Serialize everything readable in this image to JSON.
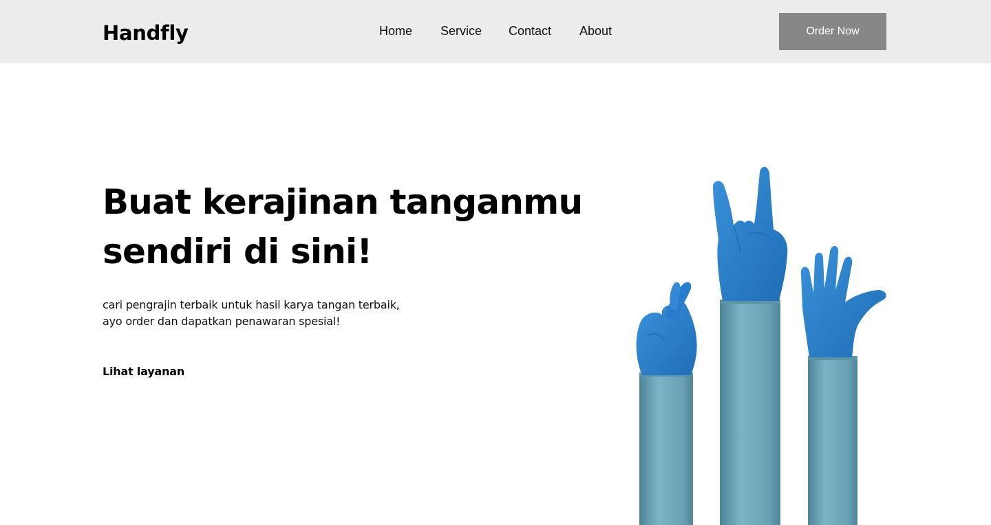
{
  "header": {
    "logo": "Handfly",
    "nav": [
      "Home",
      "Service",
      "Contact",
      "About"
    ],
    "order_button": "Order Now"
  },
  "hero": {
    "title_line1": "Buat kerajinan tanganmu",
    "title_line2": "sendiri di sini!",
    "subtitle_line1": "cari pengrajin terbaik untuk hasil karya tangan terbaik,",
    "subtitle_line2": "ayo order dan dapatkan penawaran spesial!",
    "cta": "Lihat layanan"
  },
  "illustration": {
    "glove_color": "#2f7fc8",
    "sleeve_color": "#6aa4b8"
  }
}
